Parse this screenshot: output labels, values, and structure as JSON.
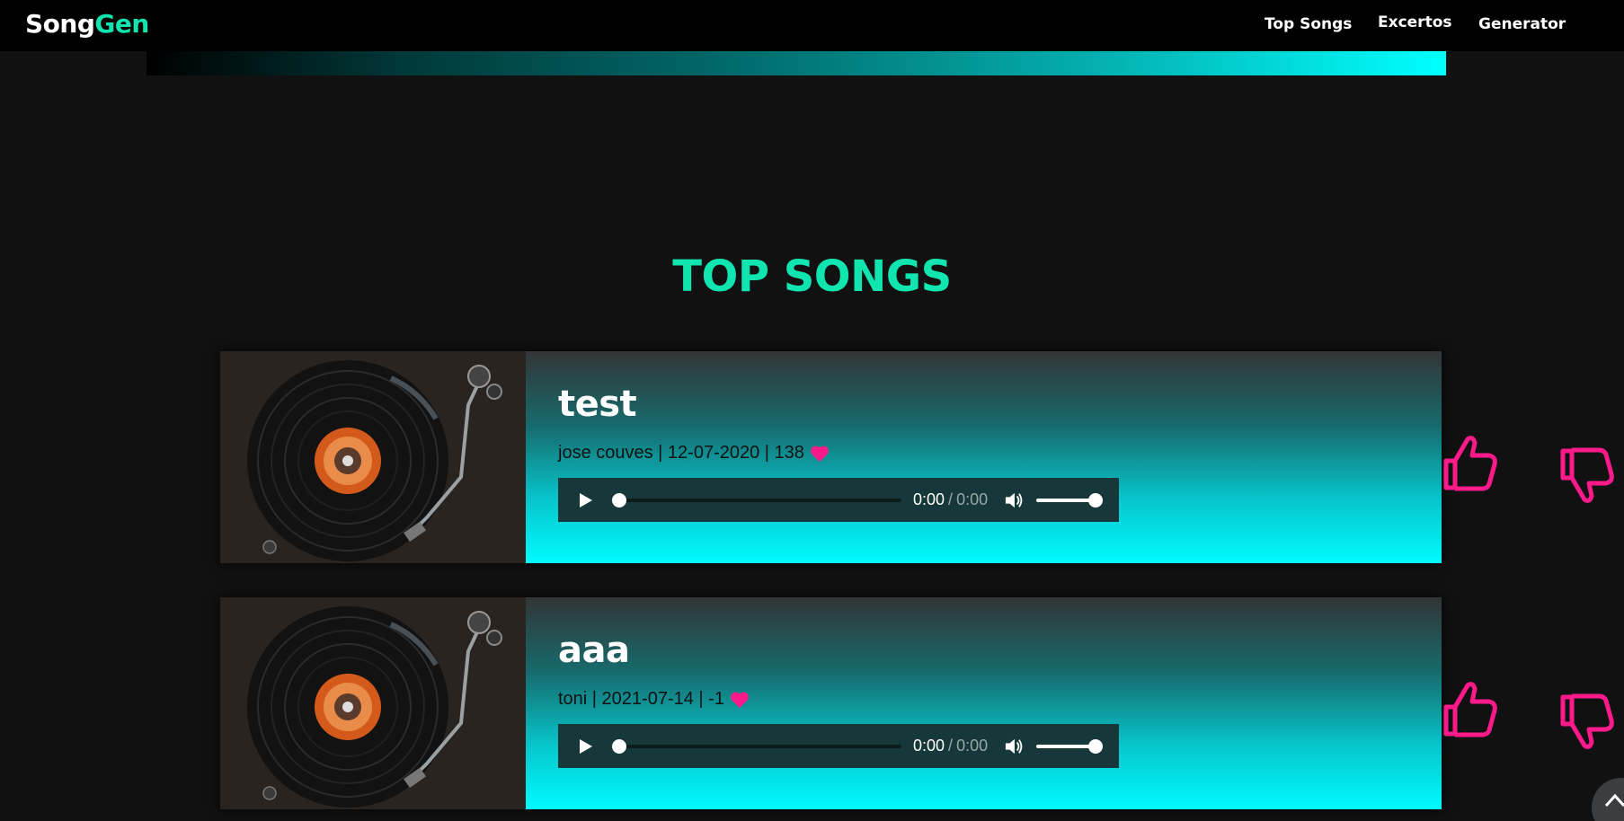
{
  "brand": {
    "part1": "Song",
    "part2": "Gen"
  },
  "nav": {
    "items": [
      {
        "label": "Top Songs"
      },
      {
        "label": "Excertos"
      },
      {
        "label": "Generator"
      }
    ]
  },
  "section": {
    "title": "TOP SONGS"
  },
  "songs": [
    {
      "title": "test",
      "meta": "jose couves | 12-07-2020 | 138",
      "player": {
        "current": "0:00",
        "separator": "/",
        "duration": "0:00",
        "progress": 0,
        "volume": 1
      }
    },
    {
      "title": "aaa",
      "meta": "toni | 2021-07-14 | -1",
      "player": {
        "current": "0:00",
        "separator": "/",
        "duration": "0:00",
        "progress": 0,
        "volume": 1
      }
    }
  ],
  "colors": {
    "accent": "#10e5b0",
    "pink": "#ff1a8c",
    "background": "#111111",
    "navbar": "#000000",
    "cyan": "#00fbff"
  },
  "icons": {
    "play": "play-icon",
    "volume": "volume-icon",
    "like": "thumbs-up-icon",
    "dislike": "thumbs-down-icon",
    "heart": "heart-icon",
    "scroll_top": "chevron-up-icon",
    "cover": "vinyl-record-image"
  }
}
